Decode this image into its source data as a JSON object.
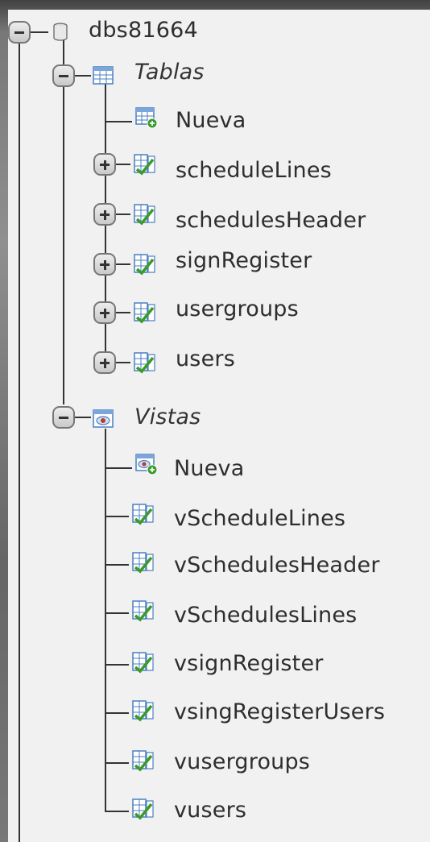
{
  "tree": {
    "root": {
      "label": "dbs81664"
    },
    "tables_group": {
      "label": "Tablas",
      "new_label": "Nueva",
      "items": [
        "scheduleLines",
        "schedulesHeader",
        "signRegister",
        "usergroups",
        "users"
      ]
    },
    "views_group": {
      "label": "Vistas",
      "new_label": "Nueva",
      "items": [
        "vScheduleLines",
        "vSchedulesHeader",
        "vSchedulesLines",
        "vsignRegister",
        "vsingRegisterUsers",
        "vusergroups",
        "vusers"
      ]
    }
  },
  "colors": {
    "panel": "#f1f1f1",
    "text": "#2e2e2e",
    "line": "#333333",
    "icon_blue": "#4a7fc1",
    "icon_green": "#3a9a2a"
  }
}
